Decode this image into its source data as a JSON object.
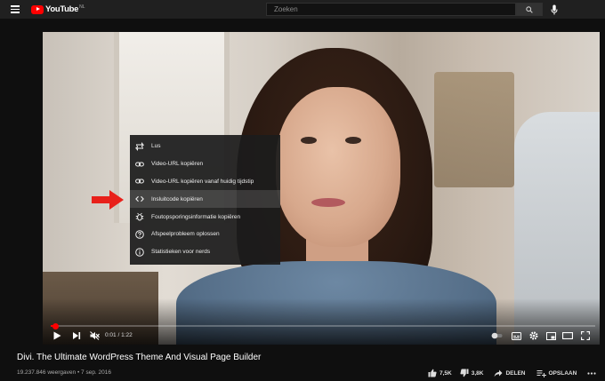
{
  "header": {
    "logo_text": "YouTube",
    "logo_country": "NL",
    "search_placeholder": "Zoeken"
  },
  "player": {
    "progress_fraction": 0.008,
    "time_current": "0:01",
    "time_separator": " / ",
    "time_total": "1:22",
    "context_menu": {
      "highlighted_index": 3,
      "items": [
        {
          "label": "Lus",
          "icon": "loop-icon"
        },
        {
          "label": "Video-URL kopiëren",
          "icon": "link-icon"
        },
        {
          "label": "Video-URL kopiëren vanaf huidig tijdstip",
          "icon": "link-icon"
        },
        {
          "label": "Insluitcode kopiëren",
          "icon": "embed-code-icon"
        },
        {
          "label": "Foutopsporingsinformatie kopiëren",
          "icon": "bug-icon"
        },
        {
          "label": "Afspeelprobleem oplossen",
          "icon": "help-icon"
        },
        {
          "label": "Statistieken voor nerds",
          "icon": "info-icon"
        }
      ]
    }
  },
  "video": {
    "title": "Divi. The Ultimate WordPress Theme And Visual Page Builder",
    "views": "19.237.846 weergaven",
    "separator": " • ",
    "date": "7 sep. 2016",
    "likes": "7,5K",
    "dislikes": "3,8K",
    "share_label": "DELEN",
    "save_label": "OPSLAAN"
  },
  "colors": {
    "brand_red": "#ff0000",
    "annotation_arrow": "#e8201a",
    "topbar": "#202020",
    "background": "#0f0f0f"
  }
}
